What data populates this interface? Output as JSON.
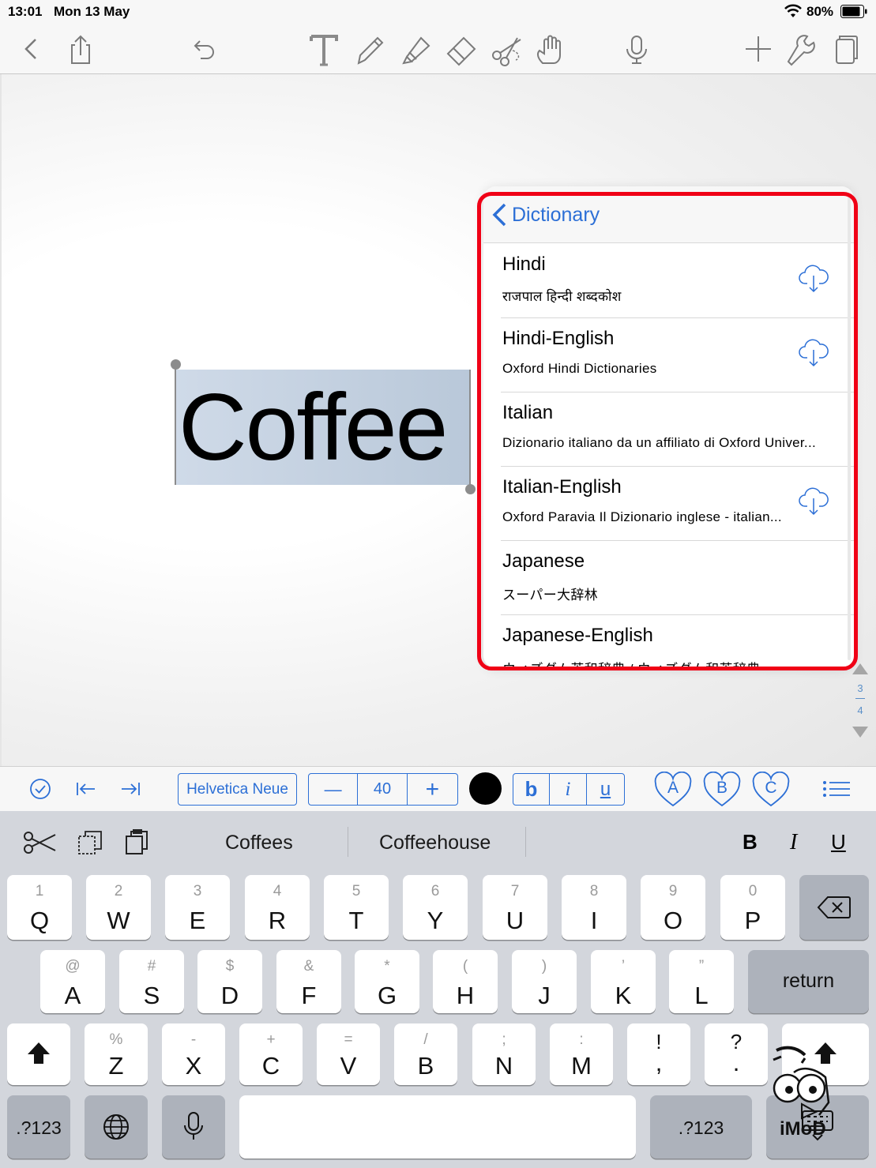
{
  "status_bar": {
    "time": "13:01",
    "date": "Mon 13 May",
    "battery": "80%"
  },
  "toolbar": {
    "icons": [
      "back-chevron-icon",
      "share-icon",
      "undo-icon",
      "text-tool-icon",
      "pen-icon",
      "highlighter-icon",
      "eraser-icon",
      "lasso-scissors-icon",
      "hand-icon",
      "microphone-icon",
      "add-icon",
      "wrench-icon",
      "page-view-icon"
    ]
  },
  "canvas": {
    "text": "Coffee"
  },
  "dictionary": {
    "back_label": "Dictionary",
    "items": [
      {
        "name": "Hindi",
        "subtitle": "राजपाल हिन्दी शब्दकोश",
        "downloadable": true
      },
      {
        "name": "Hindi-English",
        "subtitle": "Oxford Hindi Dictionaries",
        "downloadable": true
      },
      {
        "name": "Italian",
        "subtitle": "Dizionario italiano da un affiliato di Oxford Univer...",
        "downloadable": false
      },
      {
        "name": "Italian-English",
        "subtitle": "Oxford Paravia  Il Dizionario inglese - italian...",
        "downloadable": true
      },
      {
        "name": "Japanese",
        "subtitle": "スーパー大辞林",
        "downloadable": false
      },
      {
        "name": "Japanese-English",
        "subtitle": "ウィズダム英和辞典 / ウィズダム和英辞典",
        "downloadable": false
      }
    ]
  },
  "page_indicator": {
    "current": "3",
    "total": "4"
  },
  "format_bar": {
    "font": "Helvetica Neue",
    "size": "40",
    "decrease": "—",
    "increase": "+",
    "bold": "b",
    "italic": "i",
    "underline": "u",
    "color": "#000000",
    "styles": [
      "A",
      "B",
      "C"
    ]
  },
  "keyboard": {
    "suggestions": [
      "Coffees",
      "Coffeehouse"
    ],
    "format_buttons": {
      "bold": "B",
      "italic": "I",
      "underline": "U"
    },
    "row1": [
      {
        "sec": "1",
        "pri": "Q"
      },
      {
        "sec": "2",
        "pri": "W"
      },
      {
        "sec": "3",
        "pri": "E"
      },
      {
        "sec": "4",
        "pri": "R"
      },
      {
        "sec": "5",
        "pri": "T"
      },
      {
        "sec": "6",
        "pri": "Y"
      },
      {
        "sec": "7",
        "pri": "U"
      },
      {
        "sec": "8",
        "pri": "I"
      },
      {
        "sec": "9",
        "pri": "O"
      },
      {
        "sec": "0",
        "pri": "P"
      }
    ],
    "row2": [
      {
        "sec": "@",
        "pri": "A"
      },
      {
        "sec": "#",
        "pri": "S"
      },
      {
        "sec": "$",
        "pri": "D"
      },
      {
        "sec": "&",
        "pri": "F"
      },
      {
        "sec": "*",
        "pri": "G"
      },
      {
        "sec": "(",
        "pri": "H"
      },
      {
        "sec": ")",
        "pri": "J"
      },
      {
        "sec": "’",
        "pri": "K"
      },
      {
        "sec": "”",
        "pri": "L"
      }
    ],
    "row3": [
      {
        "sec": "%",
        "pri": "Z"
      },
      {
        "sec": "-",
        "pri": "X"
      },
      {
        "sec": "+",
        "pri": "C"
      },
      {
        "sec": "=",
        "pri": "V"
      },
      {
        "sec": "/",
        "pri": "B"
      },
      {
        "sec": ";",
        "pri": "N"
      },
      {
        "sec": ":",
        "pri": "M"
      },
      {
        "sec": "!",
        "pri": ","
      },
      {
        "sec": "?",
        "pri": "."
      }
    ],
    "return_label": "return",
    "numbers_label_left": ".?123",
    "numbers_label_right": ".?123"
  },
  "watermark": {
    "text": "iMoD"
  },
  "colors": {
    "accent": "#2c6fd6",
    "highlight_frame": "#f00016"
  }
}
